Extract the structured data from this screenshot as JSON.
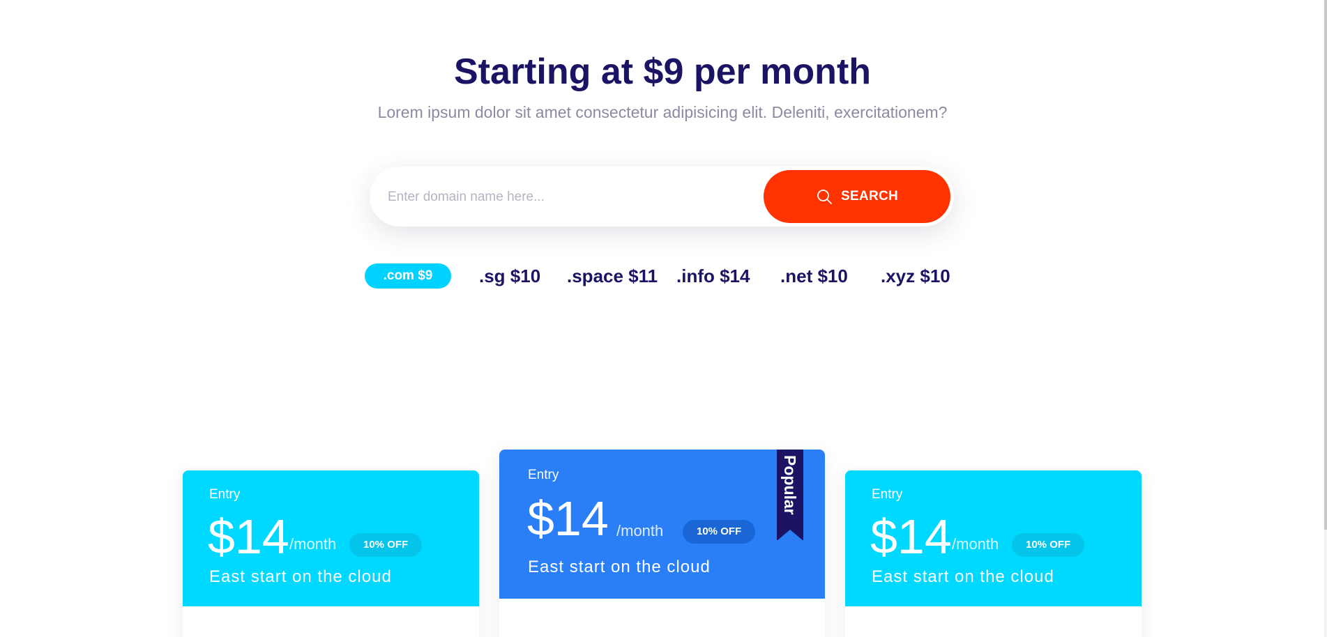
{
  "hero": {
    "title": "Starting at $9 per month",
    "subtitle": "Lorem ipsum dolor sit amet consectetur adipisicing elit. Deleniti, exercitationem?"
  },
  "search": {
    "placeholder": "Enter domain name here...",
    "button_label": "SEARCH",
    "button_icon": "search-icon",
    "button_color": "#ff3300"
  },
  "tlds": [
    {
      "label": ".com $9",
      "active": true
    },
    {
      "label": ".sg $10",
      "active": false
    },
    {
      "label": ".space $11",
      "active": false
    },
    {
      "label": ".info $14",
      "active": false
    },
    {
      "label": ".net $10",
      "active": false
    },
    {
      "label": ".xyz $10",
      "active": false
    }
  ],
  "plans": [
    {
      "tier": "Entry",
      "price": "$14",
      "period": "/month",
      "badge": "10% OFF",
      "tagline": "East start on the cloud",
      "header_color": "#00d9ff"
    },
    {
      "tier": "Entry",
      "price": "$14",
      "period": "/month",
      "badge": "10% OFF",
      "tagline": "East start on the cloud",
      "ribbon": "Popular",
      "header_color": "#2a7ff6"
    },
    {
      "tier": "Entry",
      "price": "$14",
      "period": "/month",
      "badge": "10% OFF",
      "tagline": "East start on the cloud",
      "header_color": "#00d9ff"
    }
  ],
  "colors": {
    "heading": "#1b1464",
    "muted_text": "#8a8aa3",
    "tld_active": "#00d2ff"
  }
}
